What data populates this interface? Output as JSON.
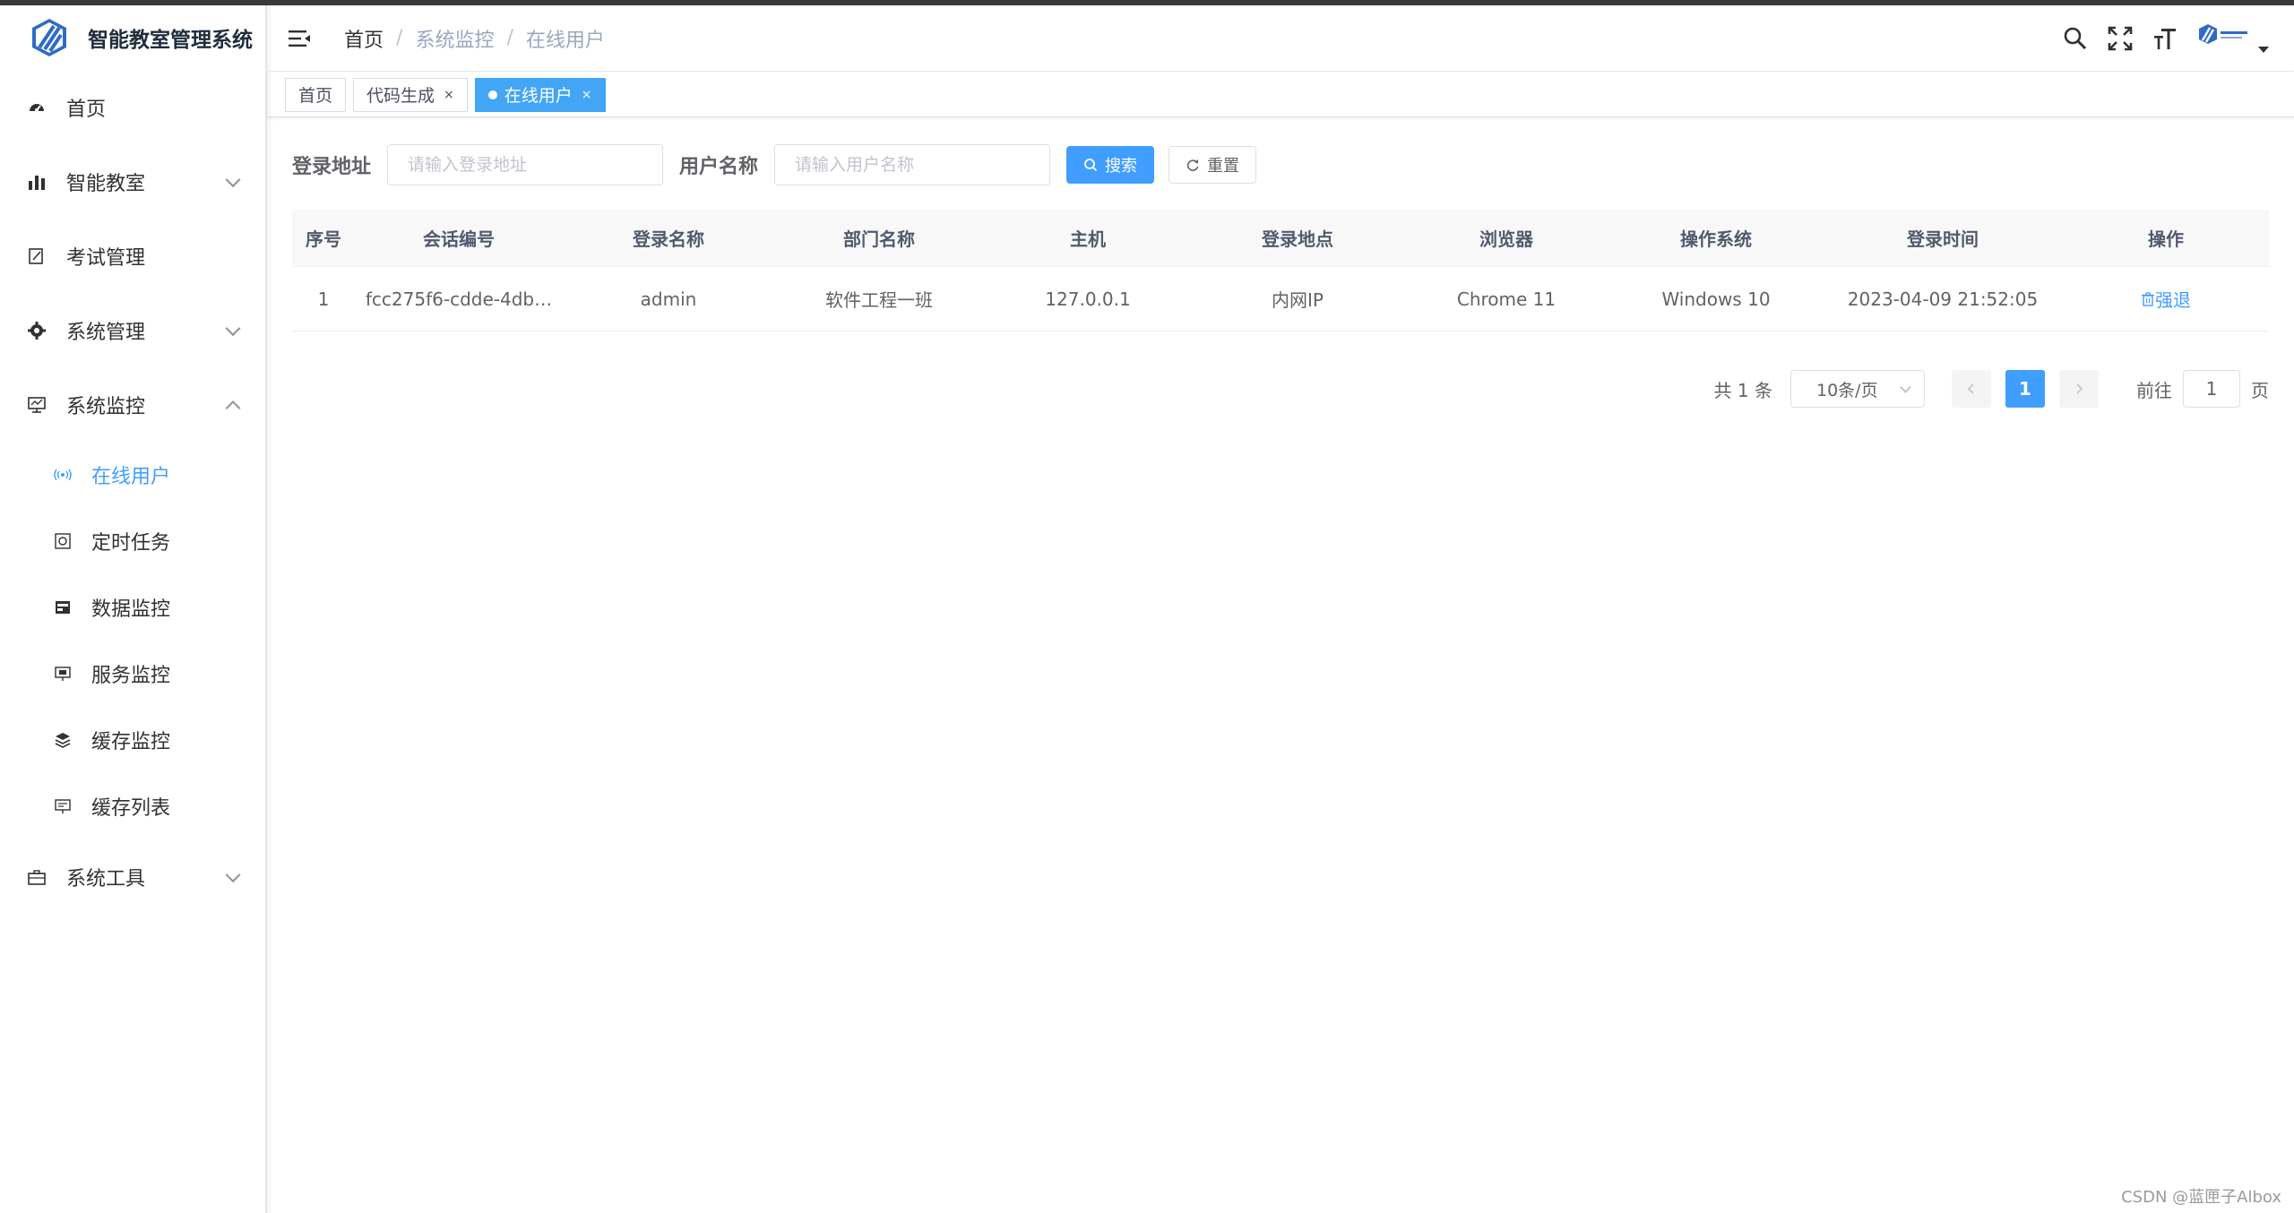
{
  "app": {
    "title": "智能教室管理系统"
  },
  "sidebar": {
    "items": [
      {
        "label": "首页",
        "icon": "dashboard-icon"
      },
      {
        "label": "智能教室",
        "icon": "chart-icon",
        "expandable": true
      },
      {
        "label": "考试管理",
        "icon": "edit-icon"
      },
      {
        "label": "系统管理",
        "icon": "gear-icon",
        "expandable": true
      },
      {
        "label": "系统监控",
        "icon": "monitor-icon",
        "expanded": true
      },
      {
        "label": "系统工具",
        "icon": "toolbox-icon",
        "expandable": true
      }
    ],
    "monitor_children": [
      {
        "label": "在线用户",
        "icon": "online-icon",
        "active": true
      },
      {
        "label": "定时任务",
        "icon": "job-icon"
      },
      {
        "label": "数据监控",
        "icon": "druid-icon"
      },
      {
        "label": "服务监控",
        "icon": "server-icon"
      },
      {
        "label": "缓存监控",
        "icon": "redis-icon"
      },
      {
        "label": "缓存列表",
        "icon": "cache-list-icon"
      }
    ]
  },
  "header": {
    "breadcrumb": [
      "首页",
      "系统监控",
      "在线用户"
    ],
    "separator": "/"
  },
  "tags": [
    {
      "label": "首页"
    },
    {
      "label": "代码生成",
      "close": "×"
    },
    {
      "label": "在线用户",
      "close": "×",
      "active": true
    }
  ],
  "search": {
    "ipaddr_label": "登录地址",
    "ipaddr_placeholder": "请输入登录地址",
    "username_label": "用户名称",
    "username_placeholder": "请输入用户名称",
    "search_btn": "搜索",
    "reset_btn": "重置"
  },
  "table": {
    "columns": [
      "序号",
      "会话编号",
      "登录名称",
      "部门名称",
      "主机",
      "登录地点",
      "浏览器",
      "操作系统",
      "登录时间",
      "操作"
    ],
    "rows": [
      [
        "1",
        "fcc275f6-cdde-4db…",
        "admin",
        "软件工程一班",
        "127.0.0.1",
        "内网IP",
        "Chrome 11",
        "Windows 10",
        "2023-04-09 21:52:05",
        "强退"
      ]
    ]
  },
  "pager": {
    "total": "共 1 条",
    "page_size": "10条/页",
    "current": "1",
    "goto_label": "前往",
    "goto_value": "1",
    "page_suffix": "页"
  },
  "watermark": "CSDN @蓝匣子Albox",
  "colors": {
    "primary": "#409eff",
    "tag_active": "#42a5f5"
  }
}
